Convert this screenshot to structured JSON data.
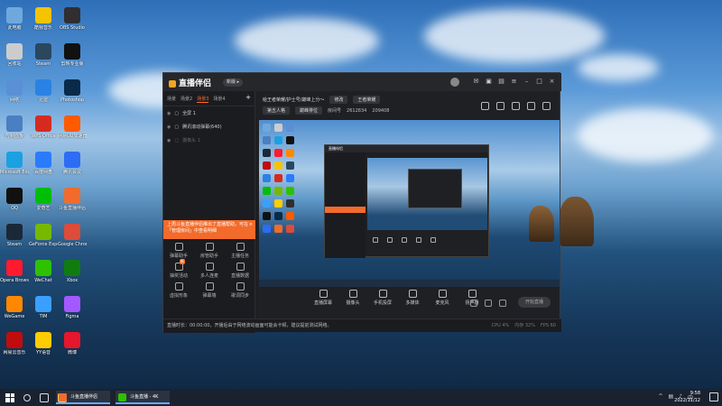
{
  "desktop": {
    "icons": [
      {
        "label": "此电脑",
        "color": "#6fa8dc",
        "icon": "computer-icon"
      },
      {
        "label": "回收站",
        "color": "#cccccc",
        "icon": "recycle-bin-icon"
      },
      {
        "label": "网络",
        "color": "#5b8fd6",
        "icon": "network-icon"
      },
      {
        "label": "控制面板",
        "color": "#4a7fc1",
        "icon": "control-panel-icon"
      },
      {
        "label": "Microsoft Edge",
        "color": "#1ba1e2",
        "icon": "edge-icon"
      },
      {
        "label": "QQ",
        "color": "#111111",
        "icon": "qq-icon"
      },
      {
        "label": "Steam",
        "color": "#1b2838",
        "icon": "steam-icon"
      },
      {
        "label": "Opera Browser",
        "color": "#ff1b2d",
        "icon": "opera-icon"
      },
      {
        "label": "WeGame",
        "color": "#ff8800",
        "icon": "wegame-icon"
      },
      {
        "label": "网易云音乐",
        "color": "#c20c0c",
        "icon": "netease-music-icon"
      },
      {
        "label": "酷我音乐",
        "color": "#f5c400",
        "icon": "kuwo-icon"
      },
      {
        "label": "Steam",
        "color": "#2a475e",
        "icon": "steam-icon"
      },
      {
        "label": "迅雷",
        "color": "#2a82e4",
        "icon": "xunlei-icon"
      },
      {
        "label": "WPS Office",
        "color": "#d52b1e",
        "icon": "wps-icon"
      },
      {
        "label": "百度网盘",
        "color": "#2b7bff",
        "icon": "baidu-netdisk-icon"
      },
      {
        "label": "爱奇艺",
        "color": "#00be06",
        "icon": "iqiyi-icon"
      },
      {
        "label": "GeForce Experience",
        "color": "#76b900",
        "icon": "nvidia-icon"
      },
      {
        "label": "WeChat",
        "color": "#2dc100",
        "icon": "wechat-icon"
      },
      {
        "label": "TIM",
        "color": "#3aa0ff",
        "icon": "tim-icon"
      },
      {
        "label": "YY语音",
        "color": "#ffcc00",
        "icon": "yy-icon"
      },
      {
        "label": "OBS Studio",
        "color": "#302e31",
        "icon": "obs-icon"
      },
      {
        "label": "剪映专业版",
        "color": "#111111",
        "icon": "jianying-icon"
      },
      {
        "label": "Photoshop",
        "color": "#0a2a4a",
        "icon": "photoshop-icon"
      },
      {
        "label": "网易UU加速器",
        "color": "#ff5a00",
        "icon": "uu-icon"
      },
      {
        "label": "腾讯会议",
        "color": "#2d6cf5",
        "icon": "tencent-meeting-icon"
      },
      {
        "label": "斗鱼直播伴侣",
        "color": "#f36b2b",
        "icon": "douyu-icon"
      },
      {
        "label": "Google Chrome",
        "color": "#dd4b39",
        "icon": "chrome-icon"
      },
      {
        "label": "Xbox",
        "color": "#107c10",
        "icon": "xbox-icon"
      },
      {
        "label": "Figma",
        "color": "#a259ff",
        "icon": "figma-icon"
      },
      {
        "label": "微博",
        "color": "#e6162d",
        "icon": "weibo-icon"
      }
    ]
  },
  "app": {
    "logo": "直播伴侣",
    "version_badge": "新版 ▸",
    "tabs": [
      "场景",
      "场景2",
      "场景3",
      "场景4"
    ],
    "active_tab_index": 2,
    "scenes": [
      {
        "label": "全屏 1",
        "dim": false
      },
      {
        "label": "腾讯滚动弹幕(640)",
        "dim": false
      },
      {
        "label": "摄像头 1",
        "dim": true
      }
    ],
    "promo": "上周斗鱼直播伴侣推出了直播帮助，可在「管理房间」中查看明细",
    "promo_close": "×",
    "tools": [
      {
        "label": "弹幕助手",
        "new": false
      },
      {
        "label": "房管助手",
        "new": false
      },
      {
        "label": "主播任务",
        "new": false
      },
      {
        "label": "抽奖活动",
        "new": true
      },
      {
        "label": "多人连麦",
        "new": false
      },
      {
        "label": "直播数据",
        "new": false
      },
      {
        "label": "虚拟形象",
        "new": false
      },
      {
        "label": "弹幕墙",
        "new": false
      },
      {
        "label": "歌词同步",
        "new": false
      }
    ],
    "new_tag": "新",
    "room": {
      "title": "给王者荣耀/护士号/巅峰上分～",
      "edit_label": "修改",
      "category": "王者荣耀",
      "tag1": "第五人格",
      "tag2": "巅峰排位",
      "id_label": "房间号",
      "viewers": "2612834",
      "followers": "209408"
    },
    "bottom_buttons": [
      {
        "label": "直播屏幕",
        "icon": "screen-icon"
      },
      {
        "label": "摄像头",
        "icon": "camera-icon"
      },
      {
        "label": "手机投屏",
        "icon": "phone-cast-icon"
      },
      {
        "label": "多媒体",
        "icon": "media-icon"
      },
      {
        "label": "麦克风",
        "icon": "microphone-icon"
      },
      {
        "label": "扬声器",
        "icon": "speaker-icon"
      }
    ],
    "start_button": "开始直播",
    "status_text": "直播时长：00:00:00，开播后由于网络波动画面可能会卡顿，建议提前测试网络。",
    "status_stats": [
      "CPU 4%",
      "内存 32%",
      "FPS 60"
    ],
    "volume_level": 0.27
  },
  "taskbar": {
    "tasks": [
      {
        "label": "斗鱼直播伴侣",
        "color": "#f36b2b"
      },
      {
        "label": "斗鱼直播 - 4K",
        "color": "#2dc100"
      }
    ],
    "time": "9:58",
    "date": "2022/11/12"
  }
}
